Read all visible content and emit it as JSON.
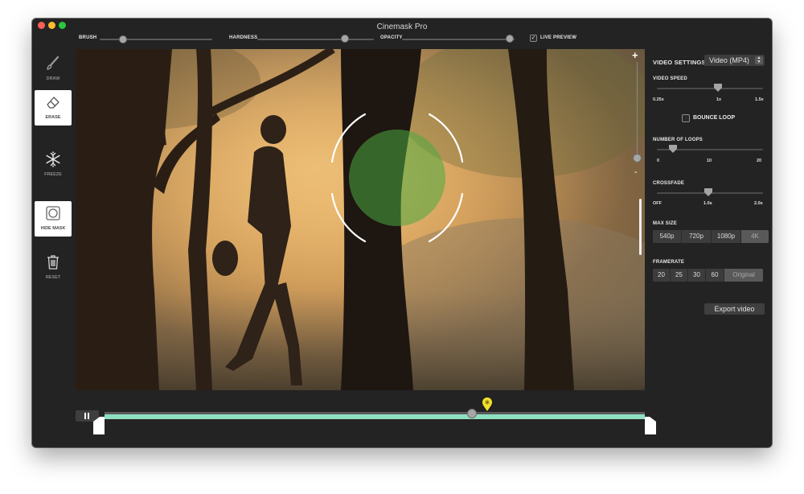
{
  "window": {
    "title": "Cinemask Pro"
  },
  "toolbar": {
    "brush_label": "BRUSH",
    "hardness_label": "HARDNESS",
    "opacity_label": "OPACITY",
    "live_preview_label": "LIVE PREVIEW",
    "live_preview_checked": true
  },
  "tools": [
    {
      "label": "DRAW",
      "icon": "brush-icon",
      "active": false
    },
    {
      "label": "ERASE",
      "icon": "eraser-icon",
      "active": true
    },
    {
      "label": "FREEZE",
      "icon": "snowflake-icon",
      "active": false
    },
    {
      "label": "HIDE MASK",
      "icon": "hide-mask-icon",
      "active": true
    },
    {
      "label": "RESET",
      "icon": "trash-icon",
      "active": false
    }
  ],
  "zoom": {
    "plus": "+",
    "minus": "-"
  },
  "settings": {
    "title": "VIDEO SETTINGS",
    "format_value": "Video (MP4)",
    "video_speed": {
      "label": "VIDEO SPEED",
      "ticks": [
        "0.25x",
        "1x",
        "1.5x"
      ]
    },
    "bounce_loop": {
      "label": "BOUNCE LOOP",
      "checked": false
    },
    "loops": {
      "label": "NUMBER OF LOOPS",
      "ticks": [
        "0",
        "10",
        "20"
      ]
    },
    "crossfade": {
      "label": "CROSSFADE",
      "ticks": [
        "OFF",
        "1.0s",
        "2.0s"
      ]
    },
    "max_size": {
      "label": "MAX SIZE",
      "options": [
        "540p",
        "720p",
        "1080p",
        "4K"
      ],
      "selected": "4K"
    },
    "framerate": {
      "label": "FRAMERATE",
      "options": [
        "20",
        "25",
        "30",
        "60",
        "Original"
      ],
      "selected": "Original"
    },
    "export_label": "Export video"
  },
  "timeline": {
    "play_state": "paused",
    "playhead_position": 0.68
  },
  "colors": {
    "accent": "#8ee0c0",
    "marker": "#f2e22a",
    "window_bg": "#232323"
  }
}
